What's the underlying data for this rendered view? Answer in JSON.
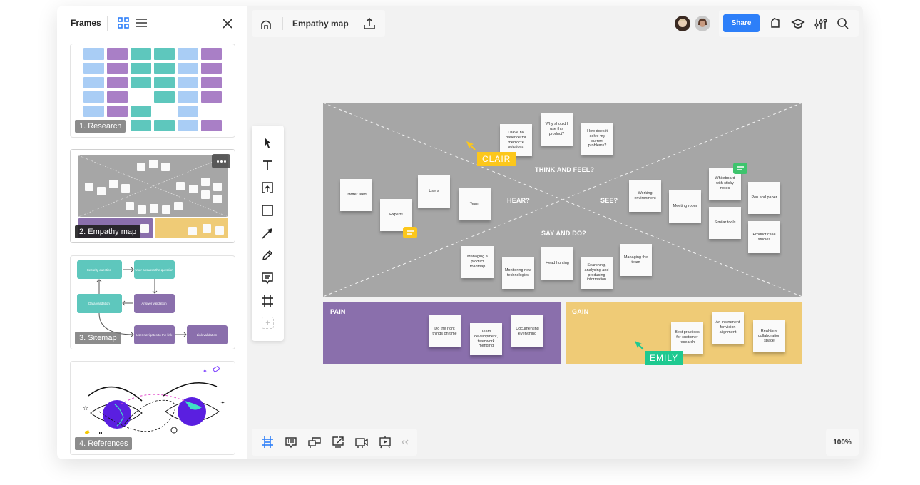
{
  "sidebar": {
    "title": "Frames",
    "view_icons": [
      "grid-view-icon",
      "list-view-icon"
    ],
    "close_icon": "close-icon",
    "frames": [
      {
        "label": "1. Research",
        "active": false
      },
      {
        "label": "2. Empathy map",
        "active": true
      },
      {
        "label": "3. Sitemap",
        "active": false
      },
      {
        "label": "4. References",
        "active": false
      }
    ],
    "sitemap_nodes": [
      "Security question",
      "User answers the question",
      "Data validation",
      "Answer validation",
      "User navigates to the link",
      "Link validation"
    ]
  },
  "topbar": {
    "home_icon": "home-icon",
    "board_title": "Empathy map",
    "upload_icon": "upload-icon",
    "share_label": "Share",
    "right_icons": [
      "tag-icon",
      "learning-cap-icon",
      "settings-sliders-icon",
      "search-icon"
    ]
  },
  "toolbar": {
    "tools": [
      "select-cursor-icon",
      "text-icon",
      "upload-frame-icon",
      "rectangle-icon",
      "arrow-icon",
      "pen-icon",
      "comment-icon",
      "frame-icon"
    ],
    "add_label": "+"
  },
  "board": {
    "sections": {
      "think": "THINK AND FEEL?",
      "hear": "HEAR?",
      "see": "SEE?",
      "say": "SAY AND DO?",
      "pain": "PAIN",
      "gain": "GAIN"
    },
    "stickies": {
      "think": [
        "I have no patience for mediocre solutions",
        "Why should I use this product?",
        "How does it solve my current problems?"
      ],
      "hear": [
        "Twitter feed",
        "Experts",
        "Users",
        "Team"
      ],
      "see": [
        "Working environment",
        "Meeting room",
        "Whiteboard with sticky notes",
        "Similar tools",
        "Pen and paper",
        "Product case studies"
      ],
      "say": [
        "Managing a product roadmap",
        "Monitoring new technologies",
        "Head hunting",
        "Searching, analysing and producing information",
        "Managing the team"
      ],
      "pain": [
        "Do the right things on time",
        "Team development, teamwork mending",
        "Documenting everything"
      ],
      "gain": [
        "Best practices for customer research",
        "An instrument for vision alignment",
        "Real-time collaboration space"
      ]
    },
    "cursors": [
      {
        "name": "CLAIR",
        "color": "#fcc71b"
      },
      {
        "name": "EMILY",
        "color": "#1ec990"
      }
    ]
  },
  "bottombar": {
    "icons": [
      "frames-icon",
      "comments-icon",
      "cards-icon",
      "share-screen-icon",
      "video-call-icon",
      "presentation-icon",
      "collapse-icon"
    ]
  },
  "zoom_level": "100%",
  "colors": {
    "accent": "#2d7ff9",
    "board_gray": "#a6a6a6",
    "pain": "#8a6fac",
    "gain": "#efcb76"
  }
}
